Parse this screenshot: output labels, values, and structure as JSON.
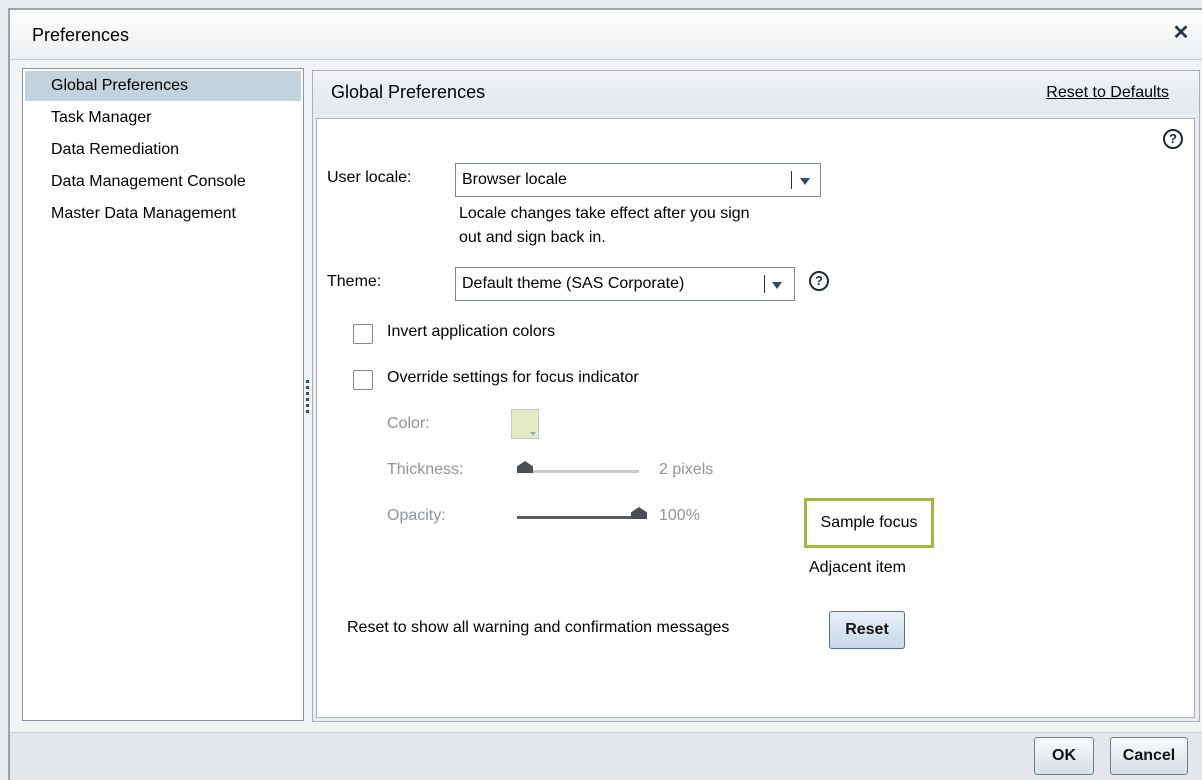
{
  "dialog": {
    "title": "Preferences",
    "close_icon": "close-icon"
  },
  "nav": {
    "items": [
      {
        "label": "Global Preferences",
        "selected": true
      },
      {
        "label": "Task Manager",
        "selected": false
      },
      {
        "label": "Data Remediation",
        "selected": false
      },
      {
        "label": "Data Management Console",
        "selected": false
      },
      {
        "label": "Master Data Management",
        "selected": false
      }
    ]
  },
  "content": {
    "title": "Global Preferences",
    "reset_defaults_label": "Reset to Defaults",
    "user_locale": {
      "label": "User locale:",
      "value": "Browser locale",
      "note_line1": "Locale changes take effect after you sign",
      "note_line2": "out and sign back in."
    },
    "theme": {
      "label": "Theme:",
      "value": "Default theme (SAS Corporate)"
    },
    "invert_colors": {
      "label": "Invert application colors",
      "checked": false
    },
    "override_focus": {
      "label": "Override settings for focus indicator",
      "checked": false
    },
    "color": {
      "label": "Color:",
      "value": "#e4ecc6"
    },
    "thickness": {
      "label": "Thickness:",
      "value_text": "2 pixels",
      "level": 0.0
    },
    "opacity": {
      "label": "Opacity:",
      "value_text": "100%",
      "level": 1.0
    },
    "sample_focus_label": "Sample focus",
    "adjacent_item_label": "Adjacent item",
    "reset_messages_label": "Reset to show all warning and confirmation messages",
    "reset_button_label": "Reset",
    "focus_color": "#9cbd3c"
  },
  "footer": {
    "ok_label": "OK",
    "cancel_label": "Cancel"
  }
}
